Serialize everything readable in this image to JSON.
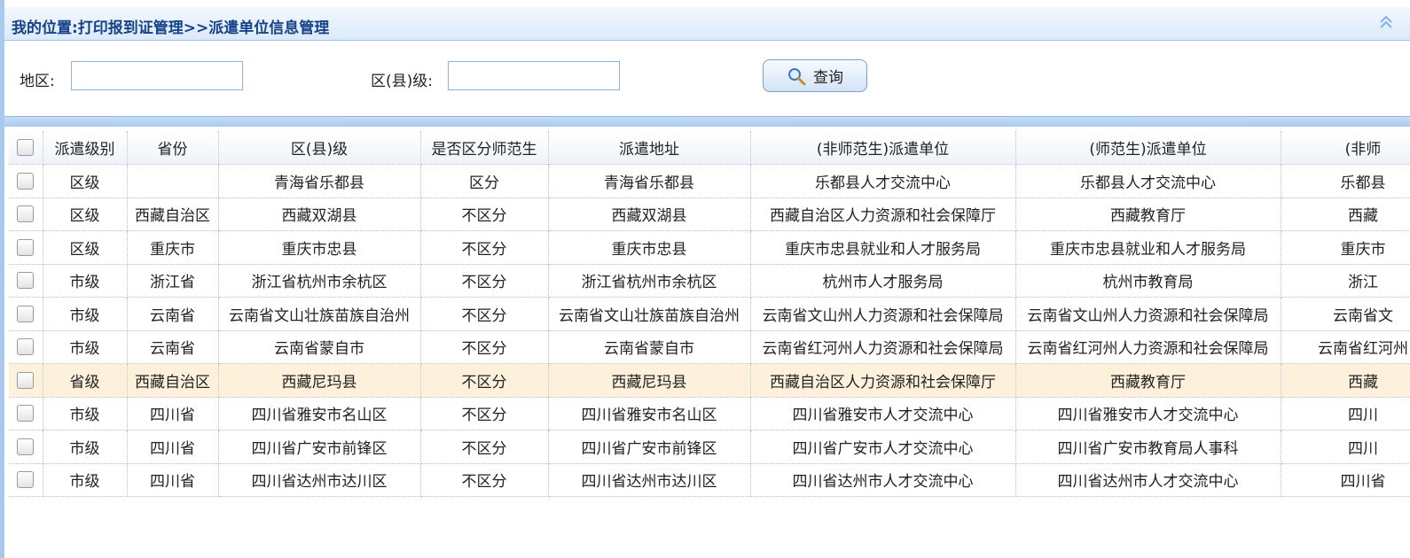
{
  "breadcrumb": "我的位置:打印报到证管理>>派遣单位信息管理",
  "filters": {
    "region_label": "地区:",
    "region_value": "",
    "district_label": "区(县)级:",
    "district_value": "",
    "query_button": "查询"
  },
  "table": {
    "columns": [
      "派遣级别",
      "省份",
      "区(县)级",
      "是否区分师范生",
      "派遣地址",
      "(非师范生)派遣单位",
      "(师范生)派遣单位",
      "(非师"
    ],
    "rows": [
      [
        "区级",
        "",
        "青海省乐都县",
        "区分",
        "青海省乐都县",
        "乐都县人才交流中心",
        "乐都县人才交流中心",
        "乐都县"
      ],
      [
        "区级",
        "西藏自治区",
        "西藏双湖县",
        "不区分",
        "西藏双湖县",
        "西藏自治区人力资源和社会保障厅",
        "西藏教育厅",
        "西藏"
      ],
      [
        "区级",
        "重庆市",
        "重庆市忠县",
        "不区分",
        "重庆市忠县",
        "重庆市忠县就业和人才服务局",
        "重庆市忠县就业和人才服务局",
        "重庆市"
      ],
      [
        "市级",
        "浙江省",
        "浙江省杭州市余杭区",
        "不区分",
        "浙江省杭州市余杭区",
        "杭州市人才服务局",
        "杭州市教育局",
        "浙江"
      ],
      [
        "市级",
        "云南省",
        "云南省文山壮族苗族自治州",
        "不区分",
        "云南省文山壮族苗族自治州",
        "云南省文山州人力资源和社会保障局",
        "云南省文山州人力资源和社会保障局",
        "云南省文"
      ],
      [
        "市级",
        "云南省",
        "云南省蒙自市",
        "不区分",
        "云南省蒙自市",
        "云南省红河州人力资源和社会保障局",
        "云南省红河州人力资源和社会保障局",
        "云南省红河州"
      ],
      [
        "省级",
        "西藏自治区",
        "西藏尼玛县",
        "不区分",
        "西藏尼玛县",
        "西藏自治区人力资源和社会保障厅",
        "西藏教育厅",
        "西藏"
      ],
      [
        "市级",
        "四川省",
        "四川省雅安市名山区",
        "不区分",
        "四川省雅安市名山区",
        "四川省雅安市人才交流中心",
        "四川省雅安市人才交流中心",
        "四川"
      ],
      [
        "市级",
        "四川省",
        "四川省广安市前锋区",
        "不区分",
        "四川省广安市前锋区",
        "四川省广安市人才交流中心",
        "四川省广安市教育局人事科",
        "四川"
      ],
      [
        "市级",
        "四川省",
        "四川省达州市达川区",
        "不区分",
        "四川省达州市达川区",
        "四川省达州市人才交流中心",
        "四川省达州市人才交流中心",
        "四川省"
      ]
    ],
    "highlighted_row_index": 6
  }
}
